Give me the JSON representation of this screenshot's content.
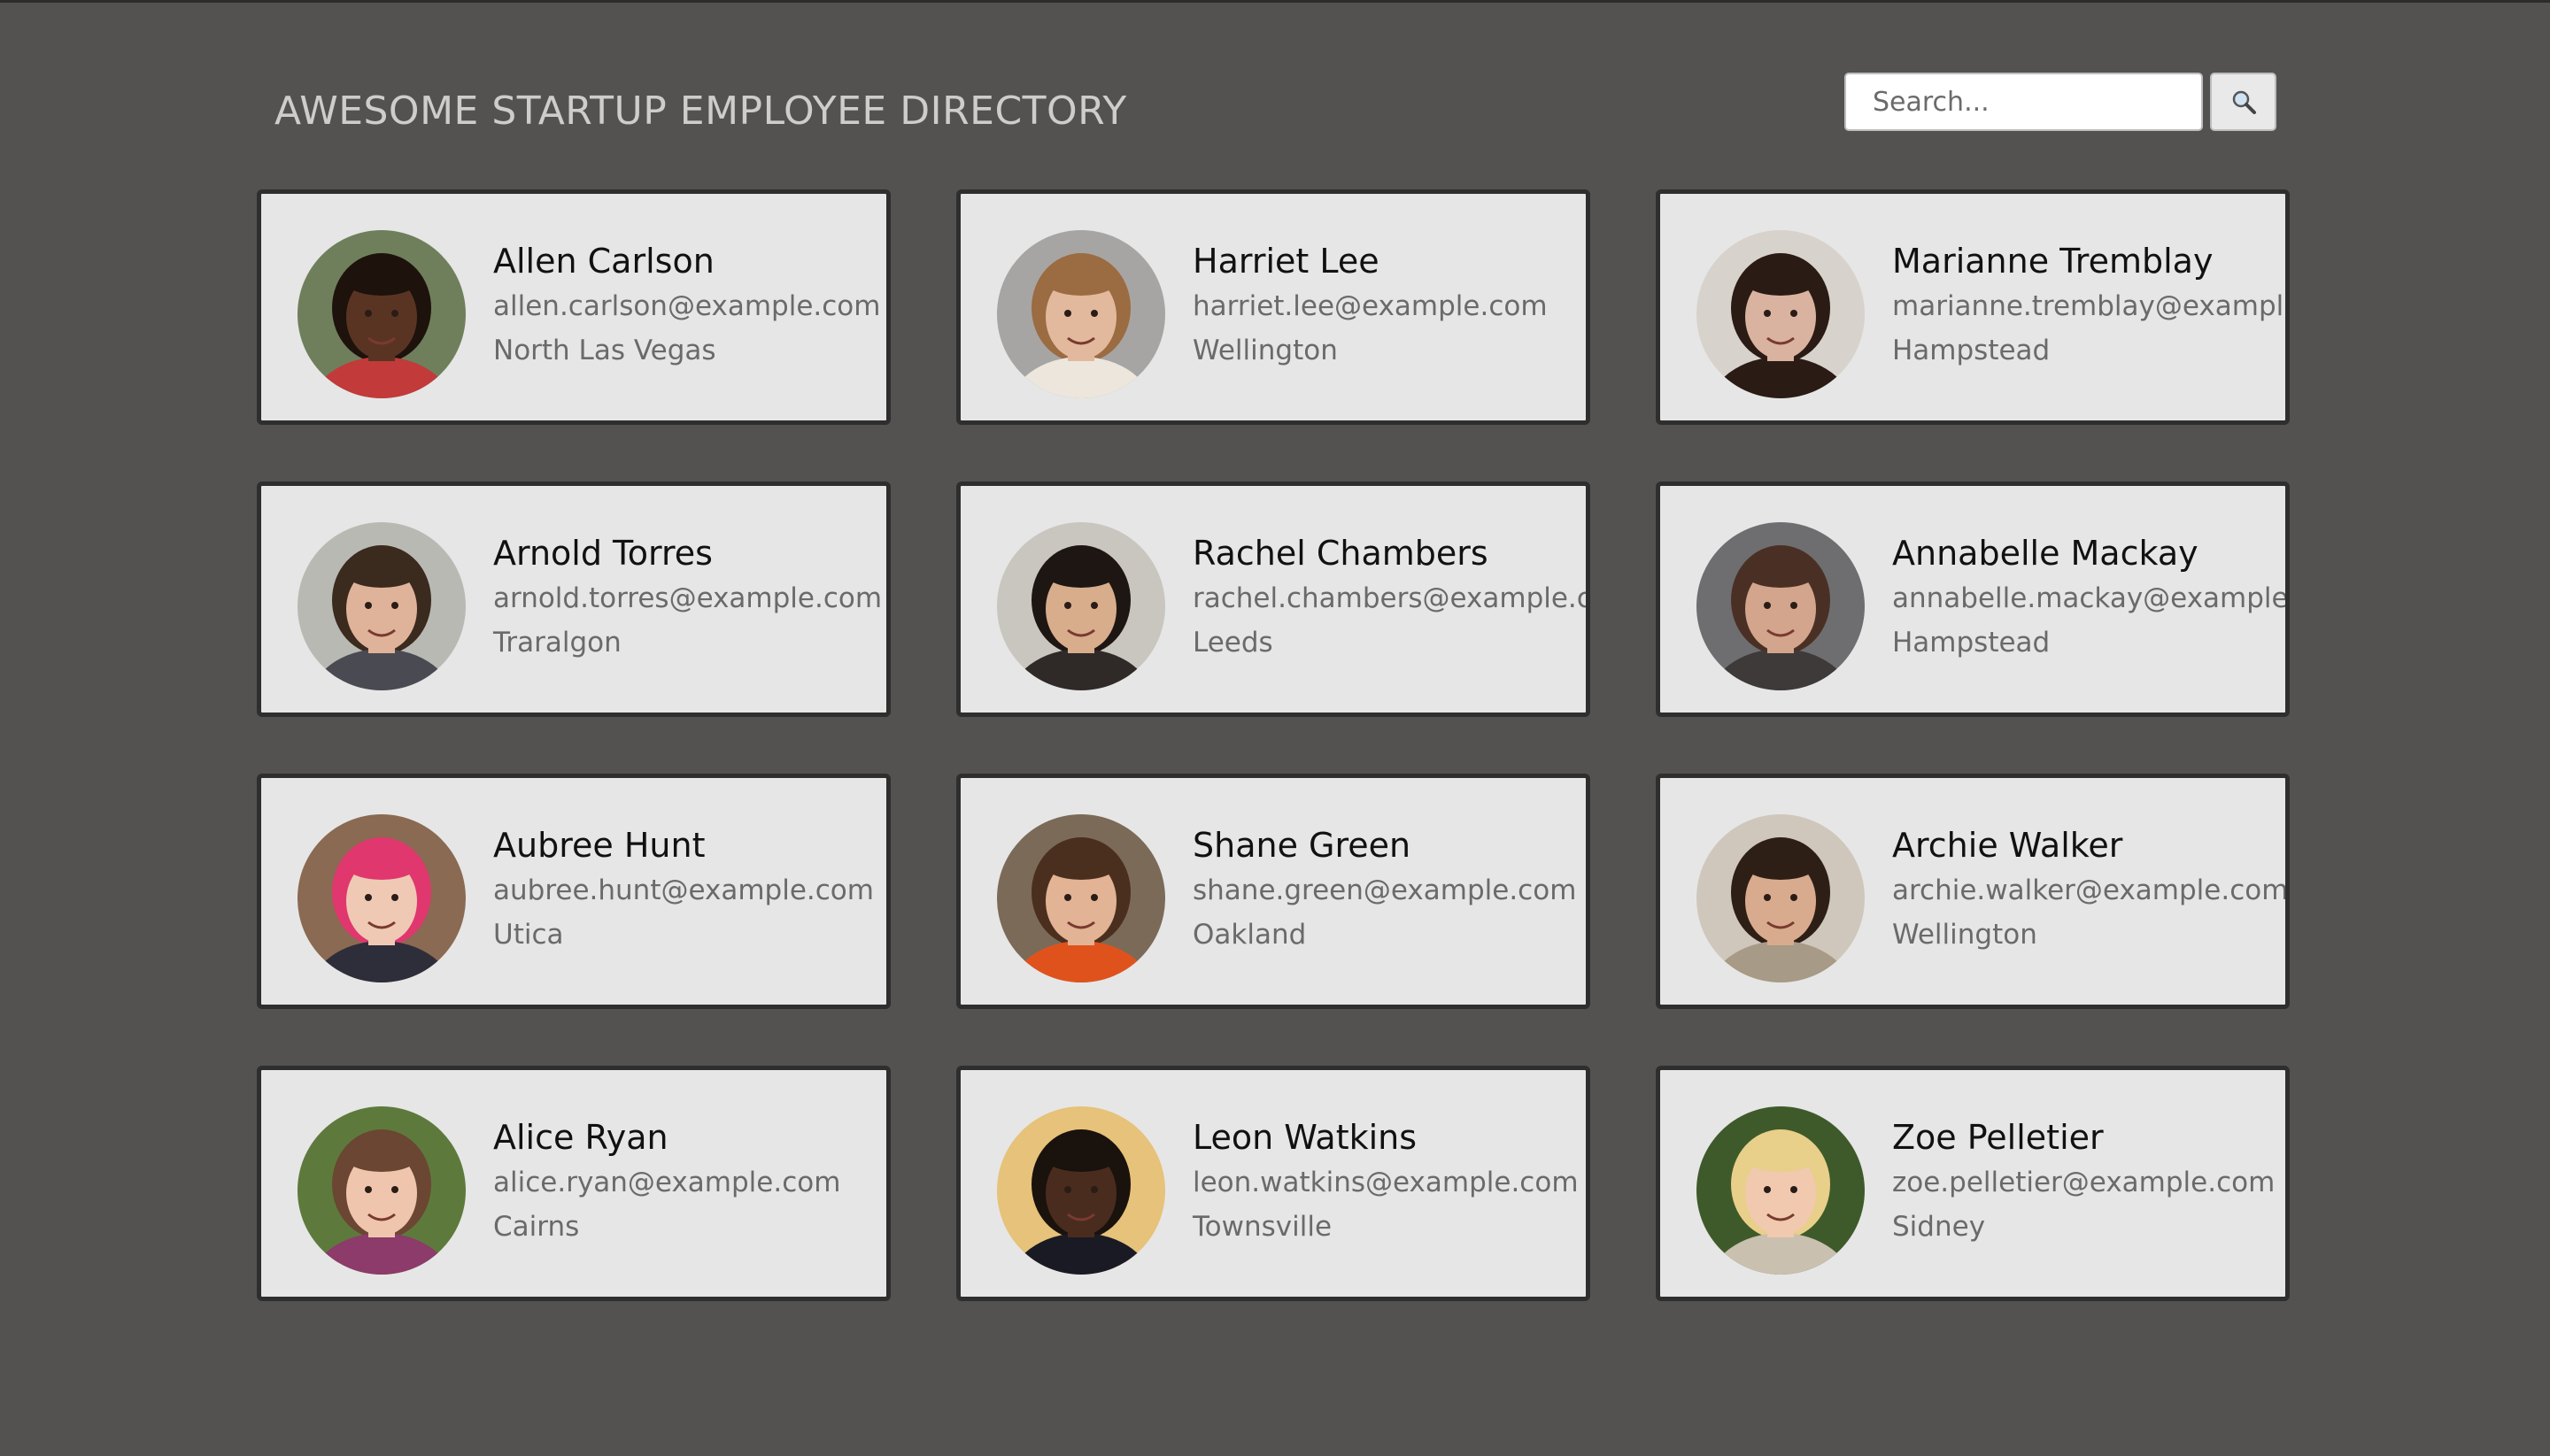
{
  "header": {
    "title": "AWESOME STARTUP EMPLOYEE DIRECTORY"
  },
  "search": {
    "placeholder": "Search...",
    "value": "",
    "button_icon": "magnifier-icon"
  },
  "colors": {
    "background": "#545151",
    "card_background": "#e6e6e6",
    "card_border": "#2e2e2e"
  },
  "employees": [
    {
      "name": "Allen Carlson",
      "email": "allen.carlson@example.com",
      "city": "North Las Vegas",
      "photo": {
        "bg": "#6f7f5c",
        "skin": "#5a3422",
        "hair": "#1d120c",
        "shirt": "#c23a3a"
      }
    },
    {
      "name": "Harriet Lee",
      "email": "harriet.lee@example.com",
      "city": "Wellington",
      "photo": {
        "bg": "#a7a5a3",
        "skin": "#e2b99c",
        "hair": "#9b6b42",
        "shirt": "#ece6dc"
      }
    },
    {
      "name": "Marianne Tremblay",
      "email": "marianne.tremblay@example.com",
      "city": "Hampstead",
      "photo": {
        "bg": "#d8d2cc",
        "skin": "#d9b3a0",
        "hair": "#2a1b14",
        "shirt": "#2a1b14"
      }
    },
    {
      "name": "Arnold Torres",
      "email": "arnold.torres@example.com",
      "city": "Traralgon",
      "photo": {
        "bg": "#b9b9b4",
        "skin": "#dfb39a",
        "hair": "#3b2a1e",
        "shirt": "#4a4a52"
      }
    },
    {
      "name": "Rachel Chambers",
      "email": "rachel.chambers@example.com",
      "city": "Leeds",
      "photo": {
        "bg": "#c9c6c0",
        "skin": "#d8ad8c",
        "hair": "#1e1612",
        "shirt": "#2f2a28"
      }
    },
    {
      "name": "Annabelle Mackay",
      "email": "annabelle.mackay@example.com",
      "city": "Hampstead",
      "photo": {
        "bg": "#6e6e70",
        "skin": "#d2a58c",
        "hair": "#4a3024",
        "shirt": "#3e3a3a"
      }
    },
    {
      "name": "Aubree Hunt",
      "email": "aubree.hunt@example.com",
      "city": "Utica",
      "photo": {
        "bg": "#8a6a52",
        "skin": "#efc9b4",
        "hair": "#e0376e",
        "shirt": "#2e2e3a"
      }
    },
    {
      "name": "Shane Green",
      "email": "shane.green@example.com",
      "city": "Oakland",
      "photo": {
        "bg": "#7b6a58",
        "skin": "#e2b395",
        "hair": "#4b2f1e",
        "shirt": "#e0521c"
      }
    },
    {
      "name": "Archie Walker",
      "email": "archie.walker@example.com",
      "city": "Wellington",
      "photo": {
        "bg": "#cfc7bb",
        "skin": "#d9ab8e",
        "hair": "#2e1f16",
        "shirt": "#a79a86"
      }
    },
    {
      "name": "Alice Ryan",
      "email": "alice.ryan@example.com",
      "city": "Cairns",
      "photo": {
        "bg": "#5d7a3c",
        "skin": "#efc6ad",
        "hair": "#6b4632",
        "shirt": "#8c3b6a"
      }
    },
    {
      "name": "Leon Watkins",
      "email": "leon.watkins@example.com",
      "city": "Townsville",
      "photo": {
        "bg": "#e6c27a",
        "skin": "#4a2c1e",
        "hair": "#1a120d",
        "shirt": "#1a1a24"
      }
    },
    {
      "name": "Zoe Pelletier",
      "email": "zoe.pelletier@example.com",
      "city": "Sidney",
      "photo": {
        "bg": "#3f5a2a",
        "skin": "#f1c9ae",
        "hair": "#e8cf8a",
        "shirt": "#c9c0b0"
      }
    }
  ]
}
